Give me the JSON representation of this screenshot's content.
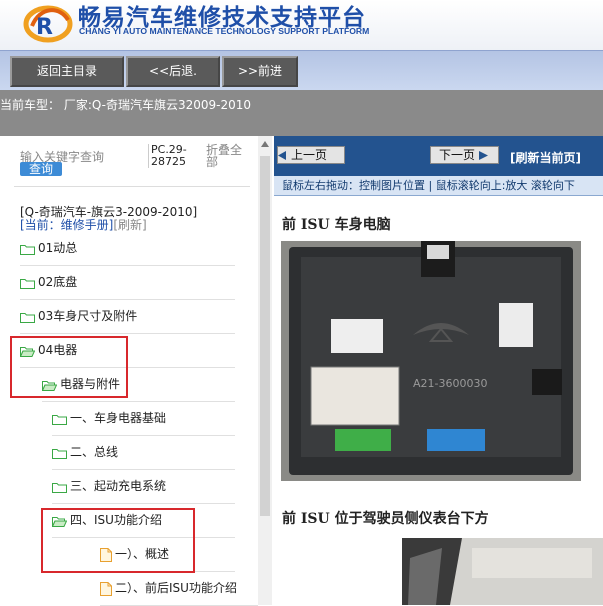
{
  "header": {
    "title_cn": "畅易汽车维修技术支持平台",
    "title_en": "CHANG YI AUTO MAINTENANCE TECHNOLOGY SUPPORT PLATFORM",
    "logo_icon": "cy-logo-icon",
    "brand_color": "#1f4fa8"
  },
  "nav": {
    "home_label": "返回主目录",
    "back_label": "<<后退.",
    "forward_label": ">>前进"
  },
  "car": {
    "label": "当前车型：  厂家:Q-奇瑞汽车旗云32009-2010"
  },
  "sidebar": {
    "search_placeholder": "输入关键字查询",
    "search_button": "查询",
    "pc_code": "PC.29-28725",
    "collapse_all": "折叠全部",
    "model_line": "[Q-奇瑞汽车-旗云3-2009-2010]",
    "current_manual": "[当前：维修手册]",
    "refresh": "[刷新]",
    "tree": [
      {
        "label": "01动总",
        "icon": "folder-icon"
      },
      {
        "label": "02底盘",
        "icon": "folder-icon"
      },
      {
        "label": "03车身尺寸及附件",
        "icon": "folder-icon"
      },
      {
        "label": "04电器",
        "icon": "folder-open-icon"
      },
      {
        "label": "电器与附件",
        "icon": "folder-open-icon"
      },
      {
        "label": "一、车身电器基础",
        "icon": "folder-icon"
      },
      {
        "label": "二、总线",
        "icon": "folder-icon"
      },
      {
        "label": "三、起动充电系统",
        "icon": "folder-icon"
      },
      {
        "label": "四、ISU功能介绍",
        "icon": "folder-open-icon"
      },
      {
        "label": "一）、概述",
        "icon": "document-icon"
      },
      {
        "label": "二）、前后ISU功能介绍",
        "icon": "document-icon"
      }
    ],
    "highlight_color": "#d8282c"
  },
  "viewer": {
    "prev_page": "上一页",
    "next_page": "下一页",
    "refresh_page": "[刷新当前页]",
    "tip": "鼠标左右拖动：控制图片位置 | 鼠标滚轮向上:放大   滚轮向下",
    "section1_title": "前 ISU 车身电脑",
    "image_label": "A21-3600030",
    "section2_title": "前 ISU 位于驾驶员侧仪表台下方",
    "topbar_color": "#23538f"
  }
}
